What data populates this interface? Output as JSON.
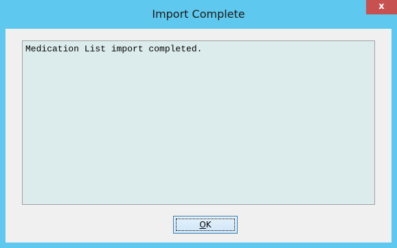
{
  "window": {
    "title": "Import Complete",
    "close_label": "x"
  },
  "message": {
    "text": "Medication List import completed."
  },
  "ok_button": {
    "mnemonic": "O",
    "rest": "K"
  },
  "colors": {
    "titlebar": "#5ec8ee",
    "close_button": "#c75050",
    "message_background": "#dcebeb"
  }
}
